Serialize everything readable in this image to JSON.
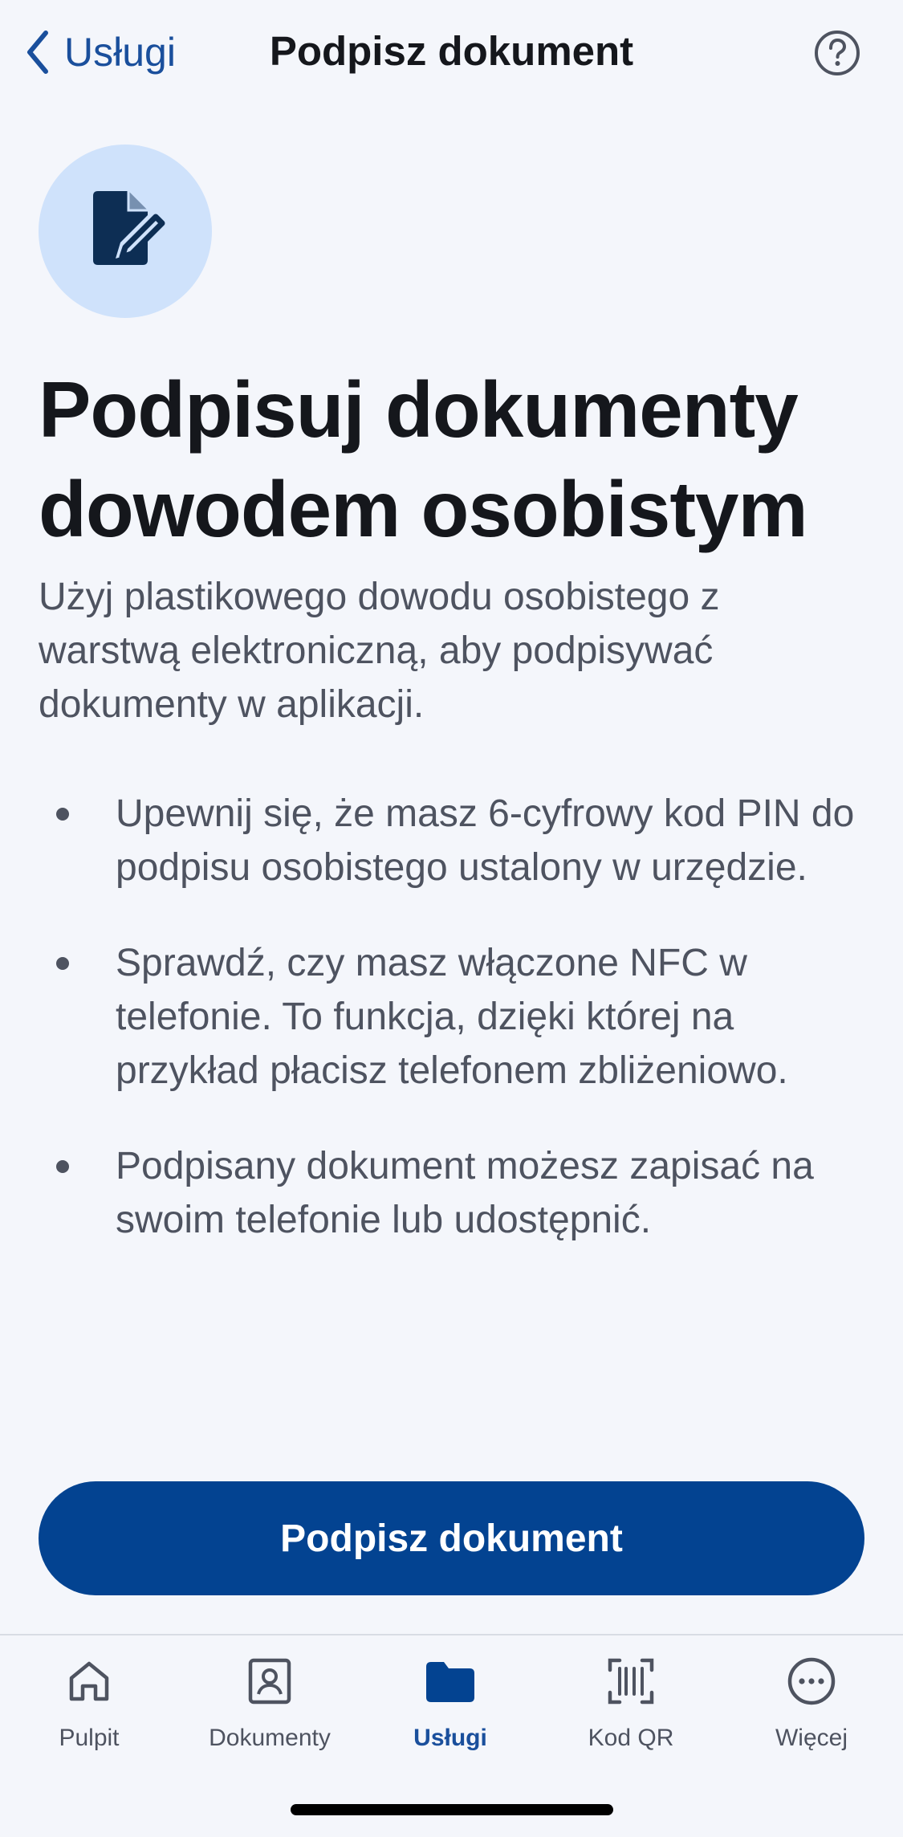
{
  "header": {
    "back_label": "Usługi",
    "title": "Podpisz dokument",
    "help_icon": "question-circle-icon"
  },
  "hero": {
    "icon": "document-sign-icon",
    "headline_line1": "Podpisuj dokumenty",
    "headline_line2": "dowodem osobistym",
    "intro": "Użyj plastikowego dowodu osobistego z warstwą elektroniczną, aby podpisywać dokumenty w aplikacji."
  },
  "bullets": [
    "Upewnij się, że masz 6-cyfrowy kod PIN do podpisu osobistego ustalony w urzędzie.",
    "Sprawdź, czy masz włączone NFC w telefonie. To funkcja, dzięki której na przykład płacisz telefonem zbliżeniowo.",
    "Podpisany dokument możesz zapisać na swoim telefonie lub udostępnić."
  ],
  "primary_button": "Podpisz dokument",
  "tabbar": {
    "active": "Usługi",
    "tabs": [
      {
        "label": "Pulpit",
        "icon": "home-icon"
      },
      {
        "label": "Dokumenty",
        "icon": "id-card-icon"
      },
      {
        "label": "Usługi",
        "icon": "folder-icon"
      },
      {
        "label": "Kod QR",
        "icon": "qr-scan-icon"
      },
      {
        "label": "Więcej",
        "icon": "more-icon"
      }
    ]
  },
  "colors": {
    "primary": "#034391",
    "accent_text": "#1a4f9c",
    "hero_circle": "#cfe2fb",
    "background": "#f4f6fb",
    "body_text": "#4e5360"
  }
}
